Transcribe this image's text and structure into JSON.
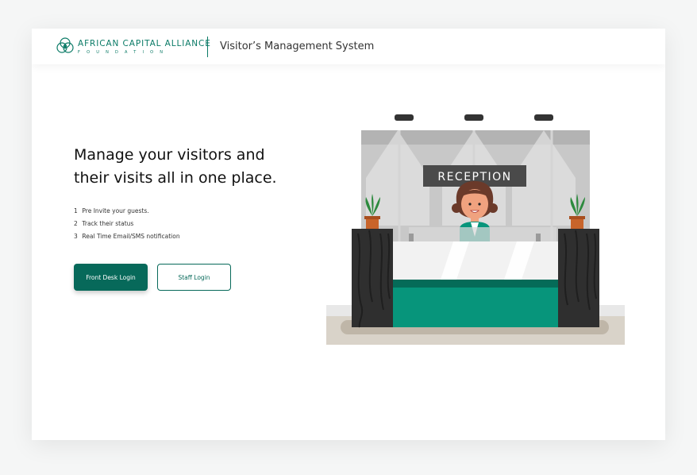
{
  "header": {
    "logo_name": "AFRICAN CAPITAL ALLIANCE",
    "logo_sub": "FOUNDATION",
    "app_title": "Visitor’s Management System"
  },
  "hero": {
    "headline": "Manage your visitors and their visits all in one place.",
    "features": [
      {
        "num": "1",
        "text": "Pre Invite your guests."
      },
      {
        "num": "2",
        "text": "Track their status"
      },
      {
        "num": "3",
        "text": "Real Time Email/SMS notification"
      }
    ],
    "front_desk_button": "Front Desk Login",
    "staff_button": "Staff Login"
  },
  "illustration": {
    "sign_text": "RECEPTION",
    "icon": "reception-desk-illustration"
  },
  "colors": {
    "brand": "#07695a",
    "brand_light": "#0a7a66",
    "counter_teal": "#07957b"
  }
}
